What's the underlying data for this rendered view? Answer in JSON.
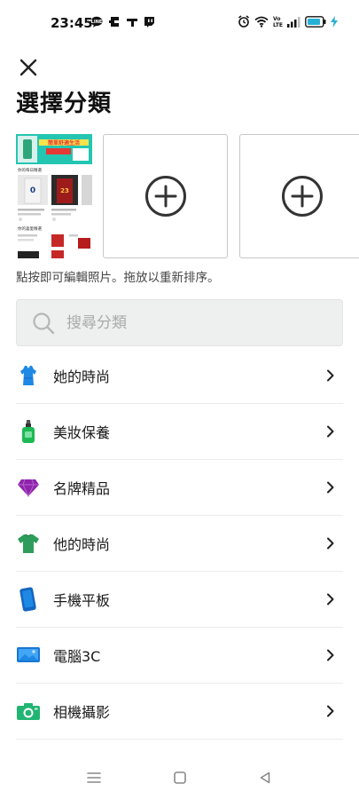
{
  "status_bar": {
    "time": "23:45",
    "left_icons": [
      "line-icon",
      "messenger-icon",
      "notification-icon",
      "twitch-icon"
    ],
    "right_icons": [
      "alarm-icon",
      "wifi-icon",
      "volte-icon",
      "signal-icon",
      "battery-icon",
      "charging-icon"
    ]
  },
  "header": {
    "title": "選擇分類"
  },
  "photos": {
    "thumbnail": {
      "banner_text": "簡單舒適生活",
      "section1": "你的每日精選",
      "section2": "你的喜愛精選"
    },
    "hint": "點按即可編輯照片。拖放以重新排序。"
  },
  "search": {
    "placeholder": "搜尋分類"
  },
  "categories": [
    {
      "label": "她的時尚",
      "icon": "dress-icon"
    },
    {
      "label": "美妝保養",
      "icon": "cosmetic-bottle-icon"
    },
    {
      "label": "名牌精品",
      "icon": "diamond-icon"
    },
    {
      "label": "他的時尚",
      "icon": "tshirt-icon"
    },
    {
      "label": "手機平板",
      "icon": "phone-icon"
    },
    {
      "label": "電腦3C",
      "icon": "monitor-icon"
    },
    {
      "label": "相機攝影",
      "icon": "camera-icon"
    }
  ],
  "colors": {
    "dress": "#1e88e5",
    "cosmetic": "#1db954",
    "diamond": "#8e24aa",
    "tshirt": "#2e9d5b",
    "phone": "#1565c0",
    "monitor": "#1976d2",
    "camera": "#21b573"
  }
}
